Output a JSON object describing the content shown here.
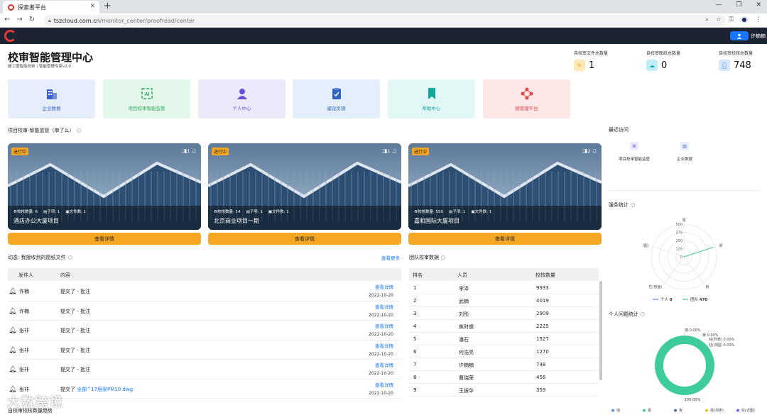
{
  "browser": {
    "tab_title": "探索者平台",
    "url_host": "tszcloud.com.cn",
    "url_path": "/monitor_center/proofread/center"
  },
  "header": {
    "user_name": "许楠楠"
  },
  "page": {
    "title": "校审智能管理中心",
    "subtitle": "施工图智能校审 | 智能管理专家v2.0"
  },
  "stats": [
    {
      "label": "自校审文件总数量",
      "value": "1",
      "color": "#fde9b8"
    },
    {
      "label": "自校审图纸总数量",
      "value": "0",
      "color": "#bfeff5"
    },
    {
      "label": "自校审校核总数量",
      "value": "748",
      "color": "#d6e6ff"
    }
  ],
  "quick_cards": [
    {
      "label": "企业数据",
      "icon": "building-icon",
      "bg": "#e6eefc",
      "fg": "#3b63c9"
    },
    {
      "label": "项目校审智能监管",
      "icon": "ai-icon",
      "bg": "#e3f7ea",
      "fg": "#2eaa5c"
    },
    {
      "label": "个人中心",
      "icon": "person-icon",
      "bg": "#ece9fb",
      "fg": "#6b4fdc"
    },
    {
      "label": "建设反馈",
      "icon": "clipboard-check-icon",
      "bg": "#e5eefb",
      "fg": "#3366bb"
    },
    {
      "label": "帮助中心",
      "icon": "bookmark-icon",
      "bg": "#e2f8f7",
      "fg": "#13a89e"
    },
    {
      "label": "微管理平台",
      "icon": "network-icon",
      "bg": "#fde7e7",
      "fg": "#e04848"
    }
  ],
  "projects_section": {
    "title": "项目校审-智能监管（审了么）"
  },
  "projects": [
    {
      "status": "进行中",
      "members": "1",
      "check_label": "校核数量:",
      "check": "6",
      "sub_label": "子项:",
      "sub": "1",
      "file_label": "文件数:",
      "files": "1",
      "name": "酒店办公大厦项目",
      "button": "查看详情"
    },
    {
      "status": "进行中",
      "members": "1",
      "check_label": "校核数量:",
      "check": "14",
      "sub_label": "子项:",
      "sub": "1",
      "file_label": "文件数:",
      "files": "1",
      "name": "北京商业项目一期",
      "button": "查看详情"
    },
    {
      "status": "进行中",
      "members": "2",
      "check_label": "校核数量:",
      "check": "550",
      "sub_label": "子项:",
      "sub": "1",
      "file_label": "文件数:",
      "files": "1",
      "name": "嘉和国际大厦项目",
      "button": "查看详情"
    }
  ],
  "recent": {
    "title": "最近访问",
    "items": [
      {
        "label": "项目校审智能监管",
        "icon": "ai-icon"
      },
      {
        "label": "企业数据",
        "icon": "building-icon"
      }
    ]
  },
  "dynamics": {
    "title": "动态: 我接收到的图纸文件",
    "more": "查看更多",
    "col_sender": "发件人",
    "col_content": "内容",
    "rows": [
      {
        "sender": "许楠",
        "content": "提交了 - 批注",
        "link": "",
        "view": "查看详情",
        "date": "2022-10-20"
      },
      {
        "sender": "许楠",
        "content": "提交了 - 批注",
        "link": "",
        "view": "查看详情",
        "date": "2022-10-20"
      },
      {
        "sender": "张非",
        "content": "提交了 - 批注",
        "link": "",
        "view": "查看详情",
        "date": "2022-10-20"
      },
      {
        "sender": "张非",
        "content": "提交了 - 批注",
        "link": "",
        "view": "查看详情",
        "date": "2022-10-20"
      },
      {
        "sender": "张非",
        "content": "提交了 - 批注",
        "link": "",
        "view": "查看详情",
        "date": "2022-10-20"
      },
      {
        "sender": "张非",
        "content": "提交了",
        "link": "全部^17层梁PM10.dwg",
        "view": "查看详情",
        "date": "2022-10-20"
      }
    ]
  },
  "team": {
    "title": "团队校审数据",
    "col_rank": "排名",
    "col_person": "人员",
    "col_count": "校核数量",
    "rows": [
      {
        "rank": "1",
        "person": "李泽",
        "count": "9933"
      },
      {
        "rank": "2",
        "person": "武楠",
        "count": "4019"
      },
      {
        "rank": "3",
        "person": "刘彤",
        "count": "2909"
      },
      {
        "rank": "4",
        "person": "焦时儒",
        "count": "2225"
      },
      {
        "rank": "5",
        "person": "潘石",
        "count": "1527"
      },
      {
        "rank": "6",
        "person": "何浩亮",
        "count": "1270"
      },
      {
        "rank": "7",
        "person": "许楠楠",
        "count": "748"
      },
      {
        "rank": "8",
        "person": "曹瑞荣",
        "count": "456"
      },
      {
        "rank": "9",
        "person": "王振华",
        "count": "359"
      }
    ]
  },
  "bottom_section": {
    "title": "自校审校核数量趋势"
  },
  "watermark": "大数跨境",
  "chart_data": [
    {
      "type": "radar",
      "title": "强条统计",
      "indicators": [
        "墙",
        "梁",
        "板",
        "柱(剖面)",
        "柱(详图)"
      ],
      "radial_ticks": [
        "500",
        "375",
        "250",
        "125",
        "0"
      ],
      "max": 500,
      "series": [
        {
          "name": "个人",
          "values": [
            0,
            0,
            0,
            0,
            0
          ],
          "total": "0",
          "color": "#5b8ff9"
        },
        {
          "name": "团队",
          "values": [
            0,
            470,
            0,
            0,
            0
          ],
          "total": "470",
          "color": "#3dcc9a"
        }
      ]
    },
    {
      "type": "pie",
      "title": "个人问题统计",
      "categories": [
        "墙",
        "梁",
        "板",
        "柱(列表)",
        "柱(详图)"
      ],
      "values": [
        0,
        100,
        0,
        0,
        0
      ],
      "labels": [
        "墙 0.00%",
        "100.00%",
        "板 0.00%",
        "柱(列表) 0.00%",
        "柱(详图) 0.00%"
      ],
      "colors": [
        "#5b8ff9",
        "#3dcc9a",
        "#5d7092",
        "#f6bd16",
        "#7262fd"
      ]
    }
  ]
}
